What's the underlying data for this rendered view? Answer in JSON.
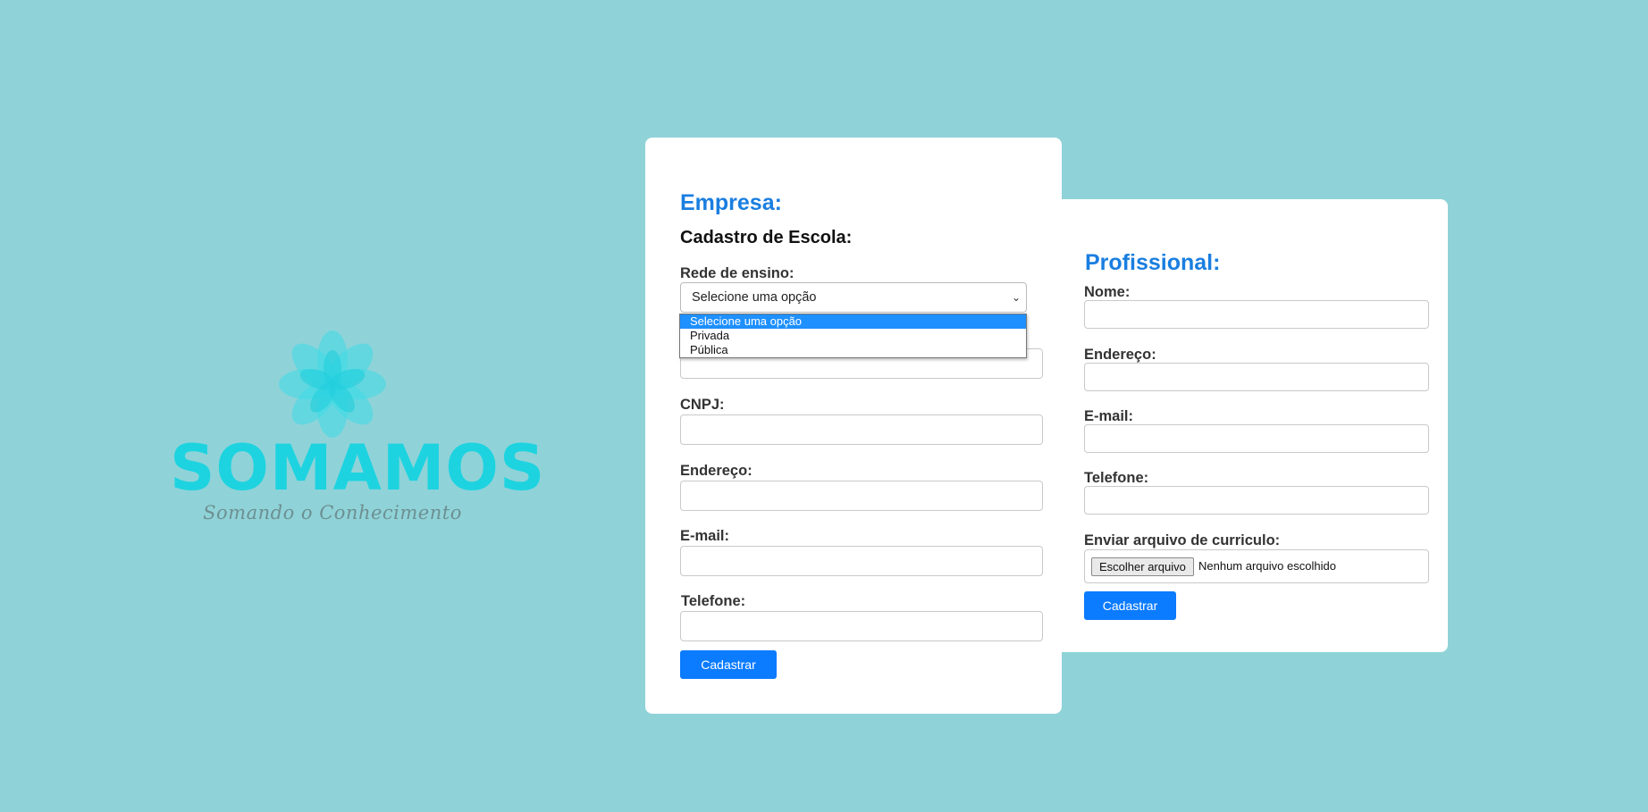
{
  "logo": {
    "word": "SOMAMOS",
    "tagline": "Somando o Conhecimento",
    "icon": "lotus-flower-icon",
    "color": "#1ed3e0"
  },
  "empresa": {
    "title": "Empresa:",
    "subtitle": "Cadastro de Escola:",
    "rede_label": "Rede de ensino:",
    "rede_selected": "Selecione uma opção",
    "rede_options": [
      "Selecione uma opção",
      "Privada",
      "Pública"
    ],
    "cnpj_label": "CNPJ:",
    "endereco_label": "Endereço:",
    "email_label": "E-mail:",
    "telefone_label": "Telefone:",
    "submit_label": "Cadastrar"
  },
  "profissional": {
    "title": "Profissional:",
    "nome_label": "Nome:",
    "endereco_label": "Endereço:",
    "email_label": "E-mail:",
    "telefone_label": "Telefone:",
    "arquivo_label": "Enviar arquivo de curriculo:",
    "file_button": "Escolher arquivo",
    "file_status": "Nenhum arquivo escolhido",
    "submit_label": "Cadastrar"
  },
  "colors": {
    "background": "#8fd3d8",
    "accent": "#0b7bff",
    "title": "#1a7ee0",
    "dropdown_highlight": "#1e90ff"
  }
}
